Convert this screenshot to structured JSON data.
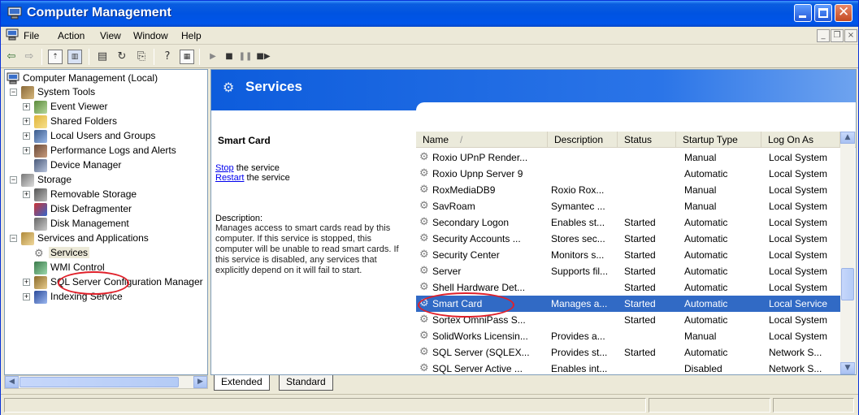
{
  "window": {
    "title": "Computer Management"
  },
  "menu": [
    "File",
    "Action",
    "View",
    "Window",
    "Help"
  ],
  "toolbar": [
    "back-icon",
    "forward-icon",
    "up-folder-icon",
    "show-hide-tree-icon",
    "properties-icon",
    "refresh-icon",
    "export-list-icon",
    "help-icon",
    "console-icon",
    "play-icon",
    "stop-icon",
    "pause-icon",
    "restart-icon"
  ],
  "tree": [
    {
      "label": "Computer Management (Local)"
    },
    {
      "label": "System Tools"
    },
    {
      "label": "Event Viewer"
    },
    {
      "label": "Shared Folders"
    },
    {
      "label": "Local Users and Groups"
    },
    {
      "label": "Performance Logs and Alerts"
    },
    {
      "label": "Device Manager"
    },
    {
      "label": "Storage"
    },
    {
      "label": "Removable Storage"
    },
    {
      "label": "Disk Defragmenter"
    },
    {
      "label": "Disk Management"
    },
    {
      "label": "Services and Applications"
    },
    {
      "label": "Services"
    },
    {
      "label": "WMI Control"
    },
    {
      "label": "SQL Server Configuration Manager"
    },
    {
      "label": "Indexing Service"
    }
  ],
  "pane": {
    "title": "Services",
    "selected_name": "Smart Card",
    "stop_link": "Stop",
    "stop_suffix": " the service",
    "restart_link": "Restart",
    "restart_suffix": " the service",
    "description_label": "Description:",
    "description": "Manages access to smart cards read by this computer. If this service is stopped, this computer will be unable to read smart cards. If this service is disabled, any services that explicitly depend on it will fail to start."
  },
  "table": {
    "columns": [
      "Name",
      "Description",
      "Status",
      "Startup Type",
      "Log On As"
    ],
    "sort_indicator": "/",
    "rows": [
      [
        "Roxio UPnP Render...",
        "",
        "",
        "Manual",
        "Local System"
      ],
      [
        "Roxio Upnp Server 9",
        "",
        "",
        "Automatic",
        "Local System"
      ],
      [
        "RoxMediaDB9",
        "Roxio Rox...",
        "",
        "Manual",
        "Local System"
      ],
      [
        "SavRoam",
        "Symantec ...",
        "",
        "Manual",
        "Local System"
      ],
      [
        "Secondary Logon",
        "Enables st...",
        "Started",
        "Automatic",
        "Local System"
      ],
      [
        "Security Accounts ...",
        "Stores sec...",
        "Started",
        "Automatic",
        "Local System"
      ],
      [
        "Security Center",
        "Monitors s...",
        "Started",
        "Automatic",
        "Local System"
      ],
      [
        "Server",
        "Supports fil...",
        "Started",
        "Automatic",
        "Local System"
      ],
      [
        "Shell Hardware Det...",
        "",
        "Started",
        "Automatic",
        "Local System"
      ],
      [
        "Smart Card",
        "Manages a...",
        "Started",
        "Automatic",
        "Local Service"
      ],
      [
        "Sortex OmniPass S...",
        "",
        "Started",
        "Automatic",
        "Local System"
      ],
      [
        "SolidWorks Licensin...",
        "Provides a...",
        "",
        "Manual",
        "Local System"
      ],
      [
        "SQL Server (SQLEX...",
        "Provides st...",
        "Started",
        "Automatic",
        "Network S..."
      ],
      [
        "SQL Server Active ...",
        "Enables int...",
        "",
        "Disabled",
        "Network S..."
      ]
    ],
    "selected_row": 9
  },
  "tabs": [
    "Extended",
    "Standard"
  ],
  "colors": {
    "titlebar": "#0055ea",
    "selection": "#316ac5",
    "highlight_circle": "#e0202a",
    "link": "#0000ee"
  }
}
